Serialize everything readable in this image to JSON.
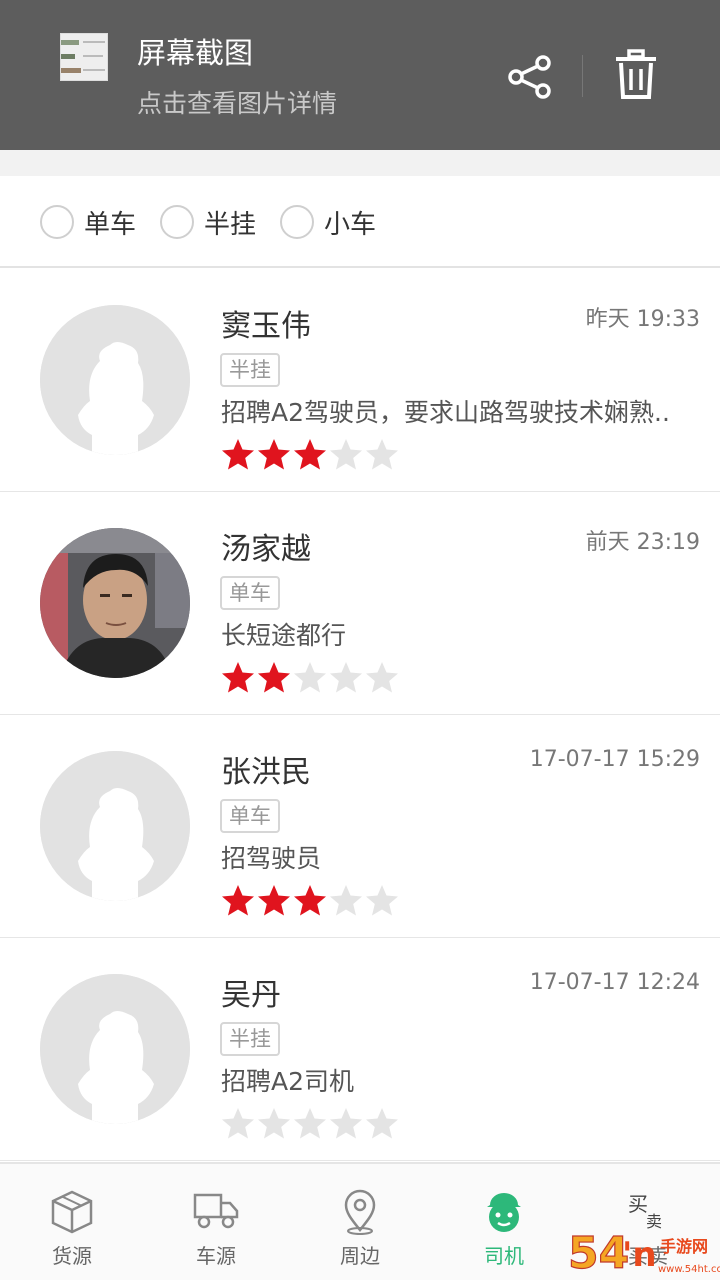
{
  "notification": {
    "title": "屏幕截图",
    "subtitle": "点击查看图片详情"
  },
  "filters": [
    {
      "label": "单车",
      "checked": false
    },
    {
      "label": "半挂",
      "checked": false
    },
    {
      "label": "小车",
      "checked": false
    }
  ],
  "drivers": [
    {
      "name": "窦玉伟",
      "time": "昨天 19:33",
      "tag": "半挂",
      "desc": "招聘A2驾驶员，要求山路驾驶技术娴熟..",
      "rating": 3,
      "avatar": "default-avatar-icon"
    },
    {
      "name": "汤家越",
      "time": "前天 23:19",
      "tag": "单车",
      "desc": "长短途都行",
      "rating": 2,
      "avatar": "user-photo"
    },
    {
      "name": "张洪民",
      "time": "17-07-17 15:29",
      "tag": "单车",
      "desc": "招驾驶员",
      "rating": 3,
      "avatar": "default-avatar-icon"
    },
    {
      "name": "吴丹",
      "time": "17-07-17 12:24",
      "tag": "半挂",
      "desc": "招聘A2司机",
      "rating": 0,
      "avatar": "default-avatar-icon"
    }
  ],
  "nav": {
    "items": [
      {
        "label": "货源",
        "icon": "box-icon"
      },
      {
        "label": "车源",
        "icon": "truck-icon"
      },
      {
        "label": "周边",
        "icon": "location-pin-icon"
      },
      {
        "label": "司机",
        "icon": "driver-icon"
      },
      {
        "label": "买卖",
        "icon": "buy-sell-icon"
      }
    ],
    "active_index": 3
  },
  "colors": {
    "header_bg": "#5d5d5d",
    "star_on": "#e0141e",
    "star_off": "#e4e4e4",
    "active_green": "#2db87a"
  },
  "watermark": {
    "text": "54'n手游网",
    "sub": "www.54ht.com"
  }
}
